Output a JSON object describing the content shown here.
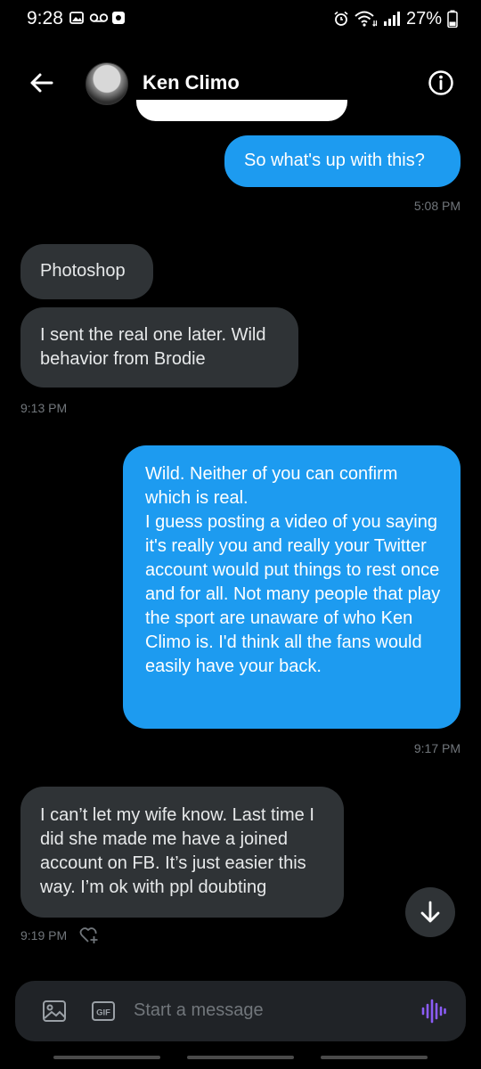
{
  "status_bar": {
    "time": "9:28",
    "battery": "27%"
  },
  "header": {
    "contact_name": "Ken Climo"
  },
  "messages": [
    {
      "text": "So what's up with this?",
      "timestamp": "5:08 PM"
    },
    {
      "text": "Photoshop"
    },
    {
      "text": "I sent the real one later. Wild behavior from Brodie",
      "timestamp": "9:13 PM"
    },
    {
      "text": "Wild. Neither of you can confirm which is real.\nI guess posting a video of you saying it's really you and really your Twitter account would put things to rest once and for all. Not many people that play the sport are unaware of who Ken Climo is. I'd think all the fans would easily have your back.",
      "timestamp": "9:17 PM"
    },
    {
      "text": "I can’t let my wife know. Last time I did she made me have a joined account on FB. It’s just easier this way. I’m ok with ppl doubting",
      "timestamp": "9:19 PM"
    }
  ],
  "composer": {
    "placeholder": "Start a message",
    "gif_label": "GIF"
  },
  "colors": {
    "sent_bubble": "#1d9bf0",
    "received_bubble": "#2f3336",
    "background": "#000000",
    "voice_icon": "#8b5cf6"
  }
}
